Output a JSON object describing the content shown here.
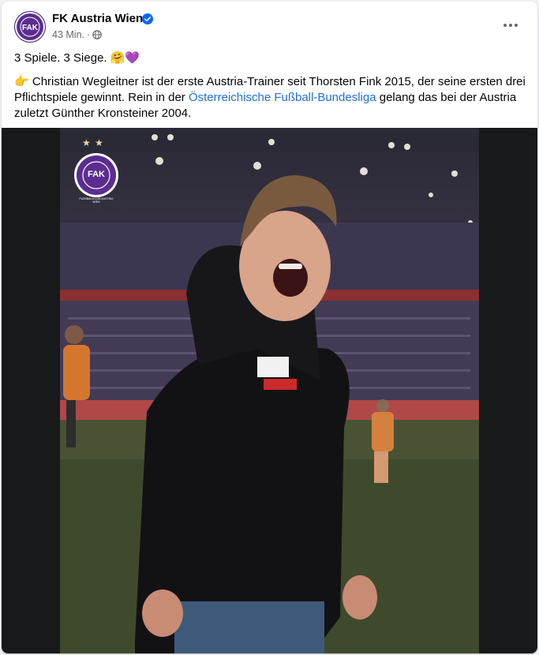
{
  "post": {
    "author": "FK Austria Wien",
    "timestamp": "43 Min.",
    "separator": "·",
    "line1": "3 Spiele. 3 Siege. 🤗💜",
    "body_emoji": "👉",
    "body_part1": " Christian Wegleitner ist der erste Austria-Trainer seit Thorsten Fink 2015, der seine ersten drei Pflichtspiele gewinnt. Rein in der ",
    "link_text": "Österreichische Fußball-Bundesliga",
    "body_part2": " gelang das bei der Austria zuletzt Günther Kronsteiner 2004."
  },
  "photo": {
    "badge_letters": "FAK",
    "badge_ring_text": "FUSSBALLKLUB AUSTRIA WIEN",
    "stars": "★ ★"
  },
  "colors": {
    "brand_purple": "#5b2d90",
    "link_blue": "#216fdb",
    "verified_blue": "#0866ff",
    "secondary_text": "#65676b"
  },
  "icons": [
    "avatar-logo",
    "verified-badge-icon",
    "globe-icon",
    "more-options-icon"
  ]
}
